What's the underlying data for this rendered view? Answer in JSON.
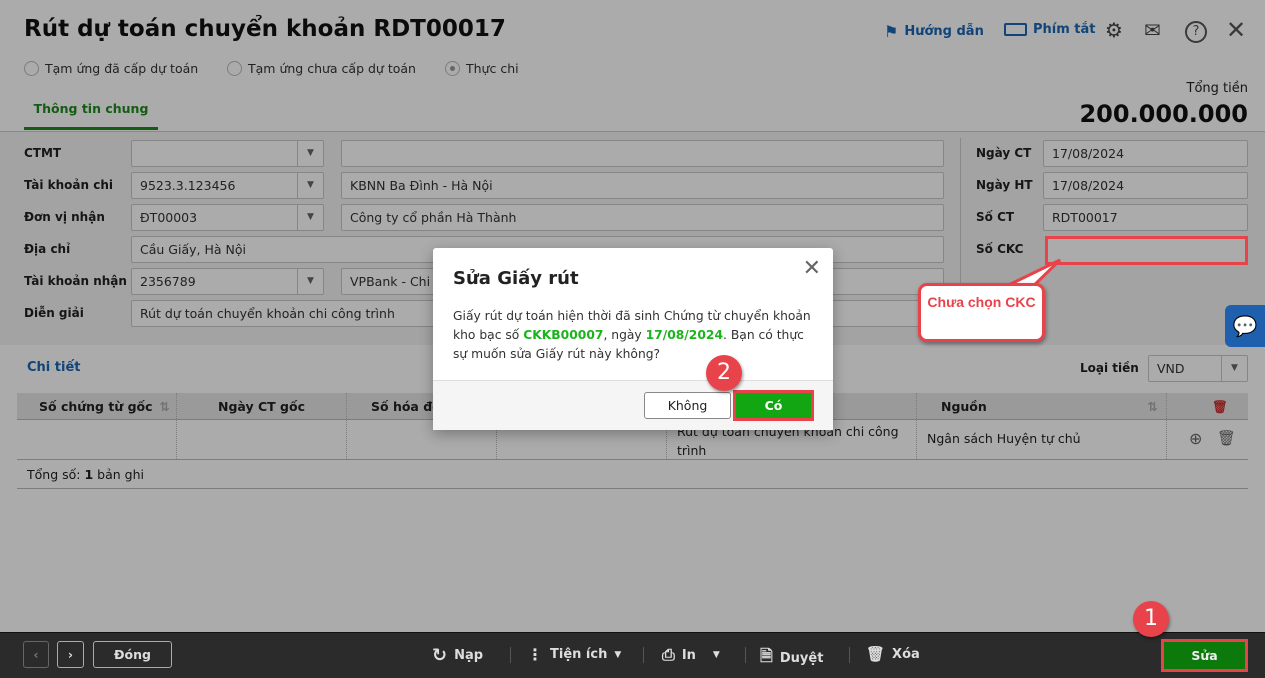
{
  "header": {
    "title": "Rút dự toán chuyển khoản RDT00017",
    "guide": "Hướng dẫn",
    "shortcuts": "Phím tắt"
  },
  "radios": [
    {
      "label": "Tạm ứng đã cấp dự toán",
      "checked": false
    },
    {
      "label": "Tạm ứng chưa cấp dự toán",
      "checked": false
    },
    {
      "label": "Thực chi",
      "checked": true
    }
  ],
  "tab": "Thông tin chung",
  "total": {
    "label": "Tổng tiền",
    "value": "200.000.000"
  },
  "form": {
    "ctmt": {
      "label": "CTMT",
      "code": "",
      "name": ""
    },
    "tk_chi": {
      "label": "Tài khoản chi",
      "code": "9523.3.123456",
      "name": "KBNN Ba Đình - Hà Nội"
    },
    "don_vi": {
      "label": "Đơn vị nhận",
      "code": "ĐT00003",
      "name": "Công ty cổ phần Hà Thành"
    },
    "dia_chi": {
      "label": "Địa chỉ",
      "value": "Cầu Giấy, Hà Nội"
    },
    "tk_nhan": {
      "label": "Tài khoản nhận",
      "code": "2356789",
      "name": "VPBank - Chi n"
    },
    "dien_giai": {
      "label": "Diễn giải",
      "value": "Rút dự toán chuyển khoản chi công trình"
    },
    "ngay_ct": {
      "label": "Ngày CT",
      "value": "17/08/2024"
    },
    "ngay_ht": {
      "label": "Ngày HT",
      "value": "17/08/2024"
    },
    "so_ct": {
      "label": "Số CT",
      "value": "RDT00017"
    },
    "so_ckc": {
      "label": "Số CKC",
      "value": ""
    }
  },
  "detail": {
    "title": "Chi tiết",
    "currency_label": "Loại tiền",
    "currency": "VND",
    "columns": [
      "Số chứng từ gốc",
      "Ngày CT gốc",
      "Số hóa đơ",
      "Nguồn"
    ],
    "row": {
      "desc": "Rút dự toán chuyển khoản chi công trình",
      "source": "Ngân sách Huyện tự chủ"
    },
    "total_prefix": "Tổng số: ",
    "total_count": "1",
    "total_suffix": " bản ghi"
  },
  "callout": "Chưa chọn CKC",
  "modal": {
    "title": "Sửa Giấy rút",
    "text1": "Giấy rút dự toán hiện thời đã sinh Chứng từ chuyển khoản kho bạc số ",
    "doc": "CKKB00007",
    "text2": ", ngày ",
    "date": "17/08/2024",
    "text3": ". Bạn có thực sự muốn sửa Giấy rút này không?",
    "no": "Không",
    "yes": "Có"
  },
  "badges": {
    "one": "1",
    "two": "2"
  },
  "footer": {
    "close": "Đóng",
    "reload": "Nạp",
    "utils": "Tiện ích",
    "print": "In",
    "approve": "Duyệt",
    "delete": "Xóa",
    "edit": "Sửa"
  }
}
